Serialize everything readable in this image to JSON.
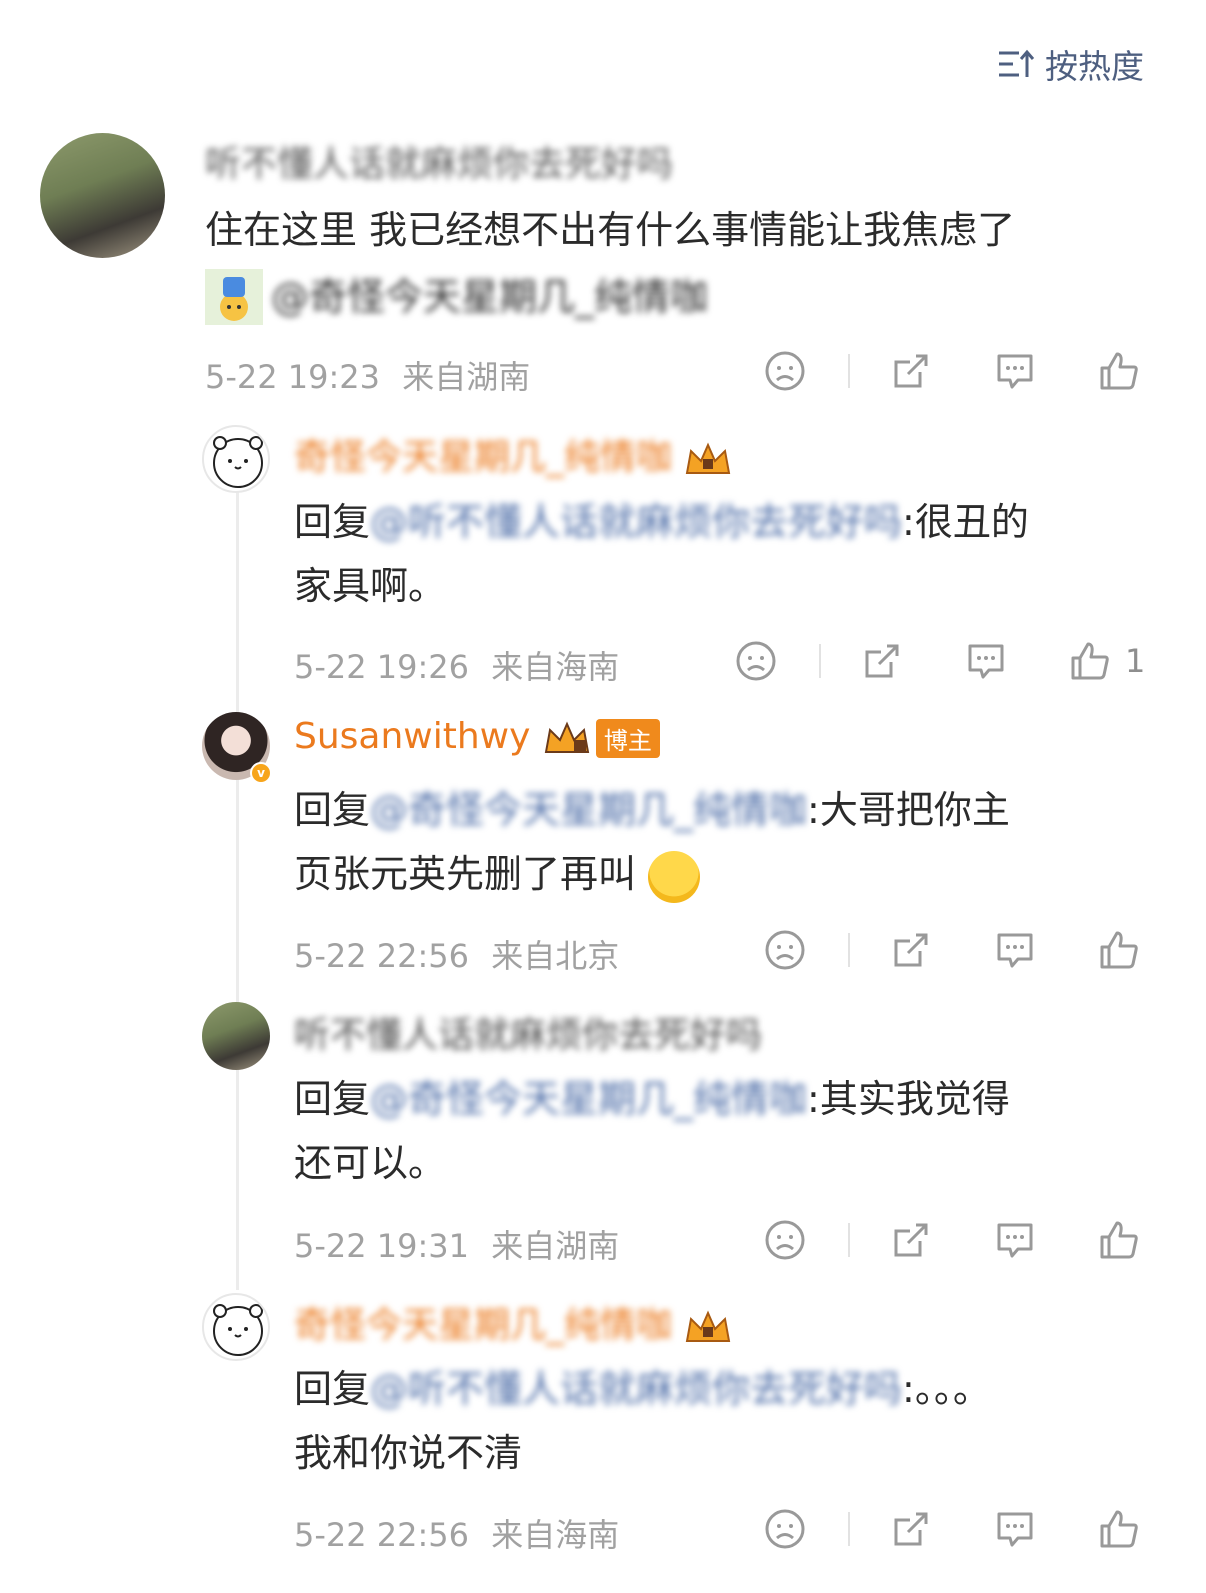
{
  "sort": {
    "label": "按热度",
    "icon": "sort-lines-icon"
  },
  "comments": [
    {
      "user": "听不懂人话就麻烦你去死好吗",
      "text": "住在这里 我已经想不出有什么事情能让我焦虑了",
      "mention": "@奇怪今天星期几_纯情咖",
      "time": "5-22 19:23",
      "location": "来自湖南",
      "likes": ""
    },
    {
      "user": "奇怪今天星期几_纯情咖",
      "reply_prefix": "回复",
      "reply_to": "@听不懂人话就麻烦你去死好吗",
      "text_line1": ":很丑的",
      "text_line2": "家具啊。",
      "time": "5-22 19:26",
      "location": "来自海南",
      "likes": "1"
    },
    {
      "user": "Susanwithwy",
      "badge": "博主",
      "reply_prefix": "回复",
      "reply_to": "@奇怪今天星期几_纯情咖",
      "text_line1": ":大哥把你主",
      "text_line2": "页张元英先删了再叫",
      "time": "5-22 22:56",
      "location": "来自北京",
      "likes": ""
    },
    {
      "user": "听不懂人话就麻烦你去死好吗",
      "reply_prefix": "回复",
      "reply_to": "@奇怪今天星期几_纯情咖",
      "text_line1": ":其实我觉得",
      "text_line2": "还可以。",
      "time": "5-22 19:31",
      "location": "来自湖南",
      "likes": ""
    },
    {
      "user": "奇怪今天星期几_纯情咖",
      "reply_prefix": "回复",
      "reply_to": "@听不懂人话就麻烦你去死好吗",
      "text_line1": ":。。。",
      "text_line2": "我和你说不清",
      "time": "5-22 22:56",
      "location": "来自海南",
      "likes": ""
    }
  ],
  "colors": {
    "username_orange": "#eb7a1e",
    "mention_blue": "#4e6ea8",
    "meta_gray": "#a1a1a1",
    "sort_blue": "#4e5f80"
  }
}
